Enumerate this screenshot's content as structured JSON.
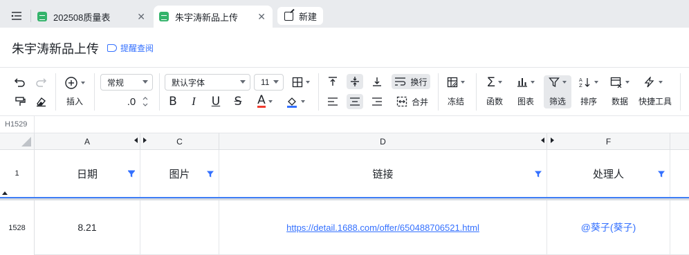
{
  "tabs": {
    "menu_icon": "list-menu-icon",
    "items": [
      {
        "label": "202508质量表",
        "icon": "sheet-icon",
        "active": false
      },
      {
        "label": "朱宇涛新品上传",
        "icon": "sheet-icon",
        "active": true
      }
    ],
    "new_label": "新建"
  },
  "document": {
    "title": "朱宇涛新品上传",
    "reminder_label": "提醒查阅"
  },
  "toolbar": {
    "insert_label": "插入",
    "format_select": "常规",
    "font_select": "默认字体",
    "size_select": "11",
    "decimal_label": ".0",
    "wrap_label": "换行",
    "merge_label": "合并",
    "freeze_label": "冻结",
    "function_label": "函数",
    "chart_label": "图表",
    "filter_label": "筛选",
    "sort_label": "排序",
    "data_label": "数据",
    "tools_label": "快捷工具"
  },
  "grid": {
    "namebox": "H1529",
    "columns": [
      {
        "letter": "A"
      },
      {
        "letter": "C"
      },
      {
        "letter": "D"
      },
      {
        "letter": "F"
      }
    ],
    "header_row": {
      "row_number": "1",
      "cells": [
        "日期",
        "图片",
        "链接",
        "处理人"
      ]
    },
    "data_rows": [
      {
        "row_number": "1528",
        "date": "8.21",
        "image": "",
        "link": "https://detail.1688.com/offer/650488706521.html",
        "handler": "@葵子(葵子)"
      }
    ]
  },
  "colors": {
    "accent": "#3370ff",
    "sheet_green": "#34b36b",
    "freeze_line": "#3d7df6"
  }
}
